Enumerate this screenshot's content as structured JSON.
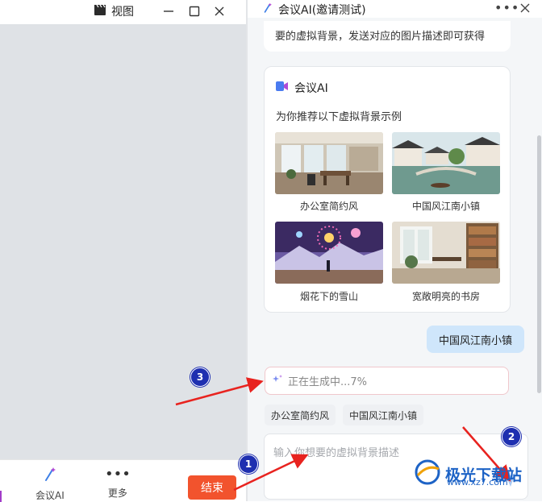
{
  "left_panel": {
    "view_label": "视图",
    "icons": {
      "view": "clapperboard-icon",
      "minimize": "minimize-icon",
      "maximize": "maximize-icon",
      "close": "close-icon"
    },
    "bottom_bar": {
      "meeting_ai_label": "会议AI",
      "more_label": "更多",
      "end_button_label": "结束"
    }
  },
  "right_panel": {
    "title": "会议AI(邀请测试)",
    "intro_text": "要的虚拟背景，发送对应的图片描述即可获得",
    "card": {
      "header": "会议AI",
      "subtitle": "为你推荐以下虚拟背景示例",
      "examples": [
        {
          "caption": "办公室简约风"
        },
        {
          "caption": "中国风江南小镇"
        },
        {
          "caption": "烟花下的雪山"
        },
        {
          "caption": "宽敞明亮的书房"
        }
      ]
    },
    "user_message": "中国风江南小镇",
    "generating_text": "正在生成中...7%",
    "suggestions": [
      "办公室简约风",
      "中国风江南小镇"
    ],
    "input_placeholder": "输入你想要的虚拟背景描述"
  },
  "annotations": {
    "markers": [
      "1",
      "2",
      "3"
    ],
    "arrow_color": "#e8231f",
    "marker_color": "#1e2fb0"
  },
  "watermark": {
    "text": "极光下载站",
    "url_text": "www.xz7.com"
  },
  "colors": {
    "accent_end_button": "#f2532d",
    "user_bubble": "#cfe6fb",
    "panel_background": "#f4f6f8"
  }
}
